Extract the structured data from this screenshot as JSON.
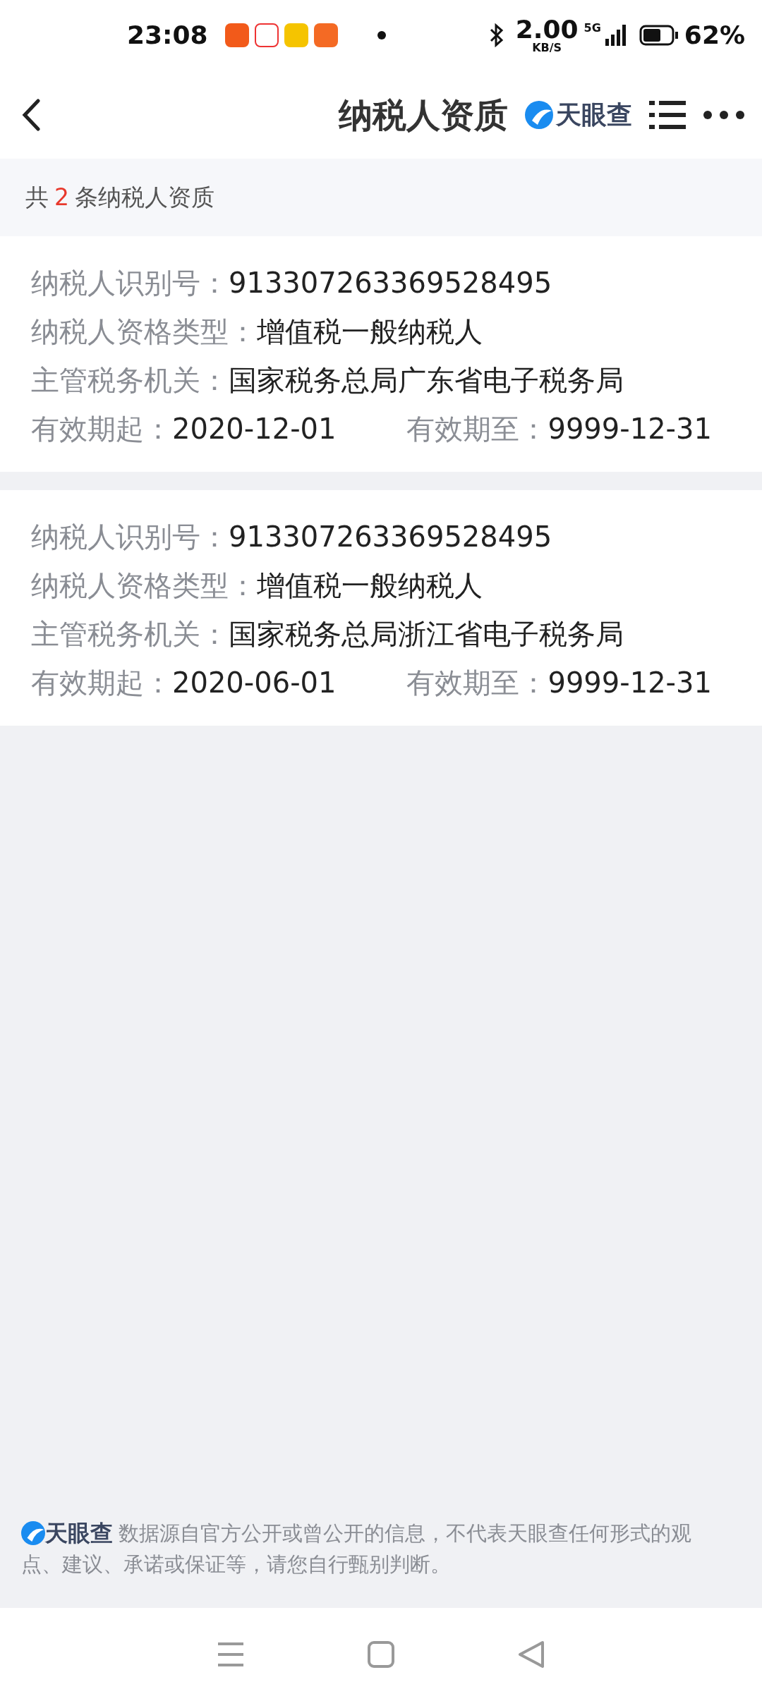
{
  "status_bar": {
    "time": "23:08",
    "net_speed": "2.00",
    "net_unit": "KB/S",
    "network": "5G",
    "battery": "62%"
  },
  "header": {
    "title": "纳税人资质",
    "brand": "天眼查"
  },
  "summary": {
    "prefix": "共",
    "count": "2",
    "suffix": "条纳税人资质"
  },
  "cards": [
    {
      "fields": [
        {
          "label": "纳税人识别号：",
          "value": "913307263369528495"
        },
        {
          "label": "纳税人资格类型：",
          "value": "增值税一般纳税人"
        },
        {
          "label": "主管税务机关：",
          "value": "国家税务总局广东省电子税务局"
        }
      ],
      "validity": [
        {
          "label": "有效期起：",
          "value": "2020-12-01"
        },
        {
          "label": "有效期至：",
          "value": "9999-12-31"
        }
      ]
    },
    {
      "fields": [
        {
          "label": "纳税人识别号：",
          "value": "913307263369528495"
        },
        {
          "label": "纳税人资格类型：",
          "value": "增值税一般纳税人"
        },
        {
          "label": "主管税务机关：",
          "value": "国家税务总局浙江省电子税务局"
        }
      ],
      "validity": [
        {
          "label": "有效期起：",
          "value": "2020-06-01"
        },
        {
          "label": "有效期至：",
          "value": "9999-12-31"
        }
      ]
    }
  ],
  "footer": {
    "brand": "天眼查",
    "disclaimer_lines": [
      "数据源自官方公开或曾公开的信息，不代表天眼查任何形式的观",
      "点、建议、承诺或保证等，请您自行甄别判断。"
    ]
  }
}
